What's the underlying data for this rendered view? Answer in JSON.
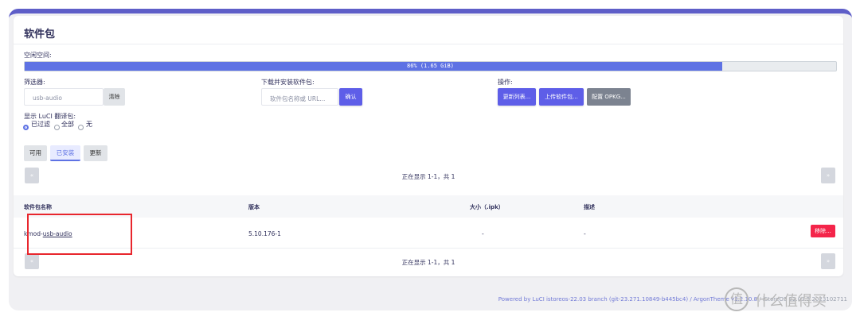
{
  "page": {
    "title": "软件包"
  },
  "space": {
    "label": "空闲空间:",
    "bar_text": "86% (1.65 GiB)",
    "fill_fraction": 0.86
  },
  "filter": {
    "label": "筛选器:",
    "value": "usb-audio",
    "clear_label": "清除"
  },
  "install": {
    "label": "下载并安装软件包:",
    "placeholder": "软件包名称或 URL...",
    "confirm_label": "确认"
  },
  "actions": {
    "label": "操作:",
    "update_lists": "更新列表...",
    "upload": "上传软件包...",
    "configure": "配置 OPKG..."
  },
  "translations": {
    "label": "显示 LuCI 翻译包:",
    "options": [
      "已过滤",
      "全部",
      "无"
    ],
    "selected_index": 0
  },
  "tabs": [
    {
      "label": "可用"
    },
    {
      "label": "已安装"
    },
    {
      "label": "更新"
    }
  ],
  "active_tab_index": 1,
  "pager": {
    "prev": "«",
    "next": "»",
    "status": "正在显示 1-1，共 1"
  },
  "table": {
    "headers": [
      "软件包名称",
      "版本",
      "大小（.ipk）",
      "描述"
    ],
    "rows": [
      {
        "name_prefix": "kmod-",
        "name_link": "usb-audio",
        "version": "5.10.176-1",
        "size": "-",
        "description": "-",
        "action": "移除..."
      }
    ]
  },
  "footer": {
    "link_text": "Powered by LuCI istoreos-22.03 branch (git-23.271.10849-b445bc4) / ArgonTheme v2.2.10.8",
    "separator": " / ",
    "version_text": "iStoreOS 22.03.5 2023102711"
  },
  "watermark": {
    "icon_text": "值",
    "text": "什么值得买"
  },
  "colors": {
    "accent": "#5e72e4",
    "button_blue": "#5e5ee8",
    "danger": "#f4254a",
    "highlight_box": "#e8262d",
    "header_rule": "#5e5ec8"
  }
}
